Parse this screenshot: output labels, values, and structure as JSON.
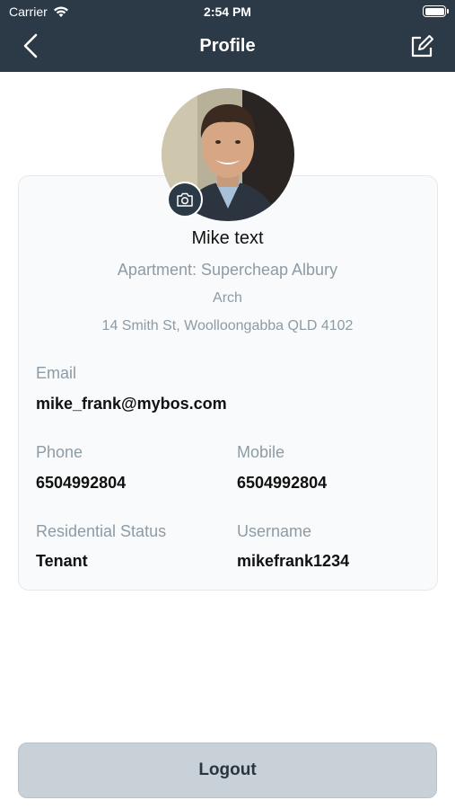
{
  "status_bar": {
    "carrier": "Carrier",
    "time": "2:54 PM"
  },
  "nav": {
    "title": "Profile",
    "back_icon": "chevron-left-icon",
    "edit_icon": "edit-icon"
  },
  "profile": {
    "name": "Mike text",
    "apartment": "Apartment: Supercheap Albury",
    "building": "Arch",
    "address": "14 Smith St, Woolloongabba QLD 4102"
  },
  "fields": {
    "email_label": "Email",
    "email_value": "mike_frank@mybos.com",
    "phone_label": "Phone",
    "phone_value": "6504992804",
    "mobile_label": "Mobile",
    "mobile_value": "6504992804",
    "status_label": "Residential Status",
    "status_value": "Tenant",
    "username_label": "Username",
    "username_value": "mikefrank1234"
  },
  "actions": {
    "logout_label": "Logout"
  },
  "colors": {
    "header": "#2c3a47",
    "muted_text": "#8e9ba4",
    "logout_bg": "#c8d1d8"
  }
}
